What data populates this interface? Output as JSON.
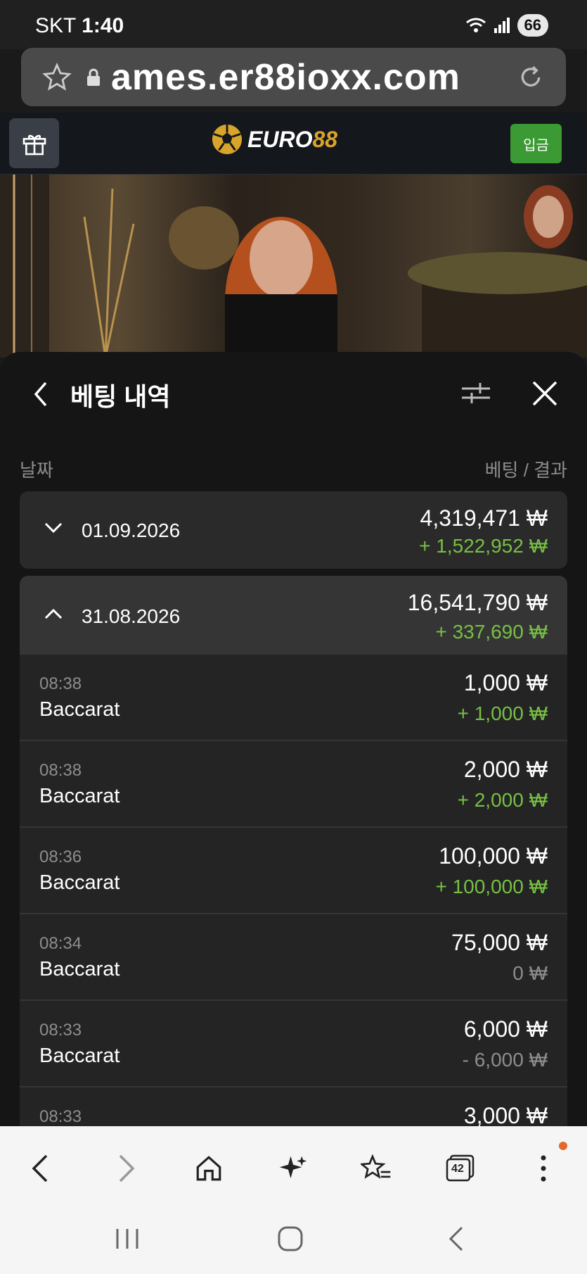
{
  "status": {
    "carrier": "SKT",
    "time": "1:40",
    "battery": "66"
  },
  "browser": {
    "url": "ames.er88ioxx.com",
    "tabs_count": "42"
  },
  "brand": {
    "logo_main": "EURO",
    "logo_accent": "88",
    "deposit_label": "입금"
  },
  "panel": {
    "title": "베팅 내역",
    "col_date": "날짜",
    "col_bet": "베팅 / 결과",
    "days": [
      {
        "date": "01.09.2026",
        "bet": "4,319,471 ₩",
        "result": "+ 1,522,952 ₩",
        "expanded": false
      },
      {
        "date": "31.08.2026",
        "bet": "16,541,790 ₩",
        "result": "+ 337,690 ₩",
        "expanded": true
      }
    ],
    "items": [
      {
        "time": "08:38",
        "game": "Baccarat",
        "amount": "1,000 ₩",
        "result": "+ 1,000 ₩",
        "status": "win"
      },
      {
        "time": "08:38",
        "game": "Baccarat",
        "amount": "2,000 ₩",
        "result": "+ 2,000 ₩",
        "status": "win"
      },
      {
        "time": "08:36",
        "game": "Baccarat",
        "amount": "100,000 ₩",
        "result": "+ 100,000 ₩",
        "status": "win"
      },
      {
        "time": "08:34",
        "game": "Baccarat",
        "amount": "75,000 ₩",
        "result": "0 ₩",
        "status": "neutral"
      },
      {
        "time": "08:33",
        "game": "Baccarat",
        "amount": "6,000 ₩",
        "result": "- 6,000 ₩",
        "status": "loss"
      },
      {
        "time": "08:33",
        "game": "",
        "amount": "3,000 ₩",
        "result": "",
        "status": "neutral"
      }
    ]
  },
  "colors": {
    "accent_green": "#77c043",
    "deposit_green": "#3c9a34",
    "logo_gold": "#d9a42a"
  }
}
